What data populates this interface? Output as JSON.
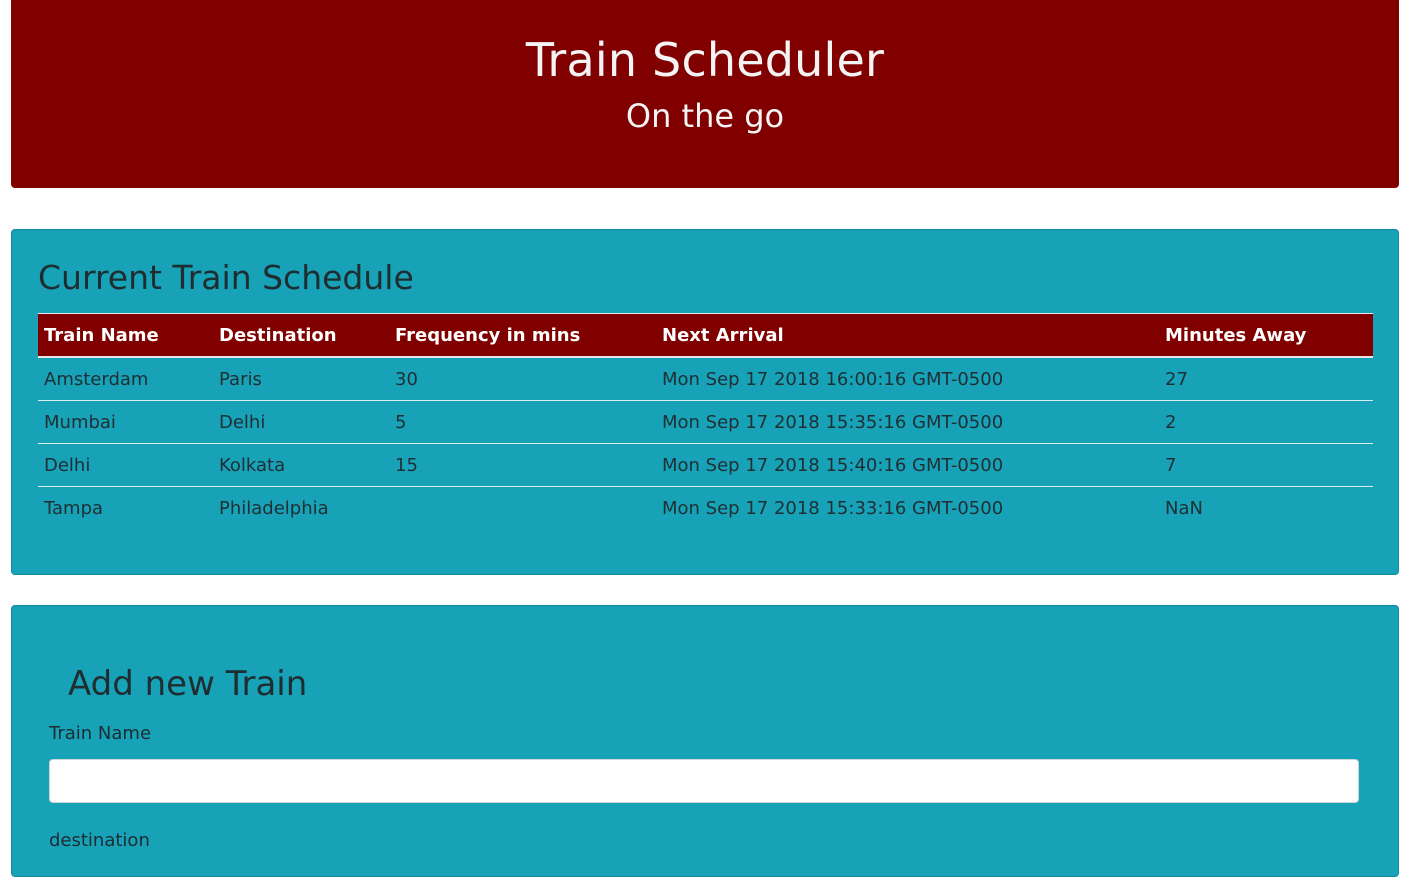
{
  "header": {
    "title": "Train Scheduler",
    "subtitle": "On the go"
  },
  "schedule": {
    "heading": "Current Train Schedule",
    "columns": [
      "Train Name",
      "Destination",
      "Frequency in mins",
      "Next Arrival",
      "Minutes Away"
    ],
    "rows": [
      [
        "Amsterdam",
        "Paris",
        "30",
        "Mon Sep 17 2018 16:00:16 GMT-0500",
        "27"
      ],
      [
        "Mumbai",
        "Delhi",
        "5",
        "Mon Sep 17 2018 15:35:16 GMT-0500",
        "2"
      ],
      [
        "Delhi",
        "Kolkata",
        "15",
        "Mon Sep 17 2018 15:40:16 GMT-0500",
        "7"
      ],
      [
        "Tampa",
        "Philadelphia",
        "",
        "Mon Sep 17 2018 15:33:16 GMT-0500",
        "NaN"
      ]
    ]
  },
  "form": {
    "heading": "Add new Train",
    "train_name_label": "Train Name",
    "train_name_value": "",
    "destination_label": "destination"
  },
  "colors": {
    "header_bg": "#800000",
    "card_bg": "#17a2b8",
    "table_header_bg": "#800000"
  }
}
